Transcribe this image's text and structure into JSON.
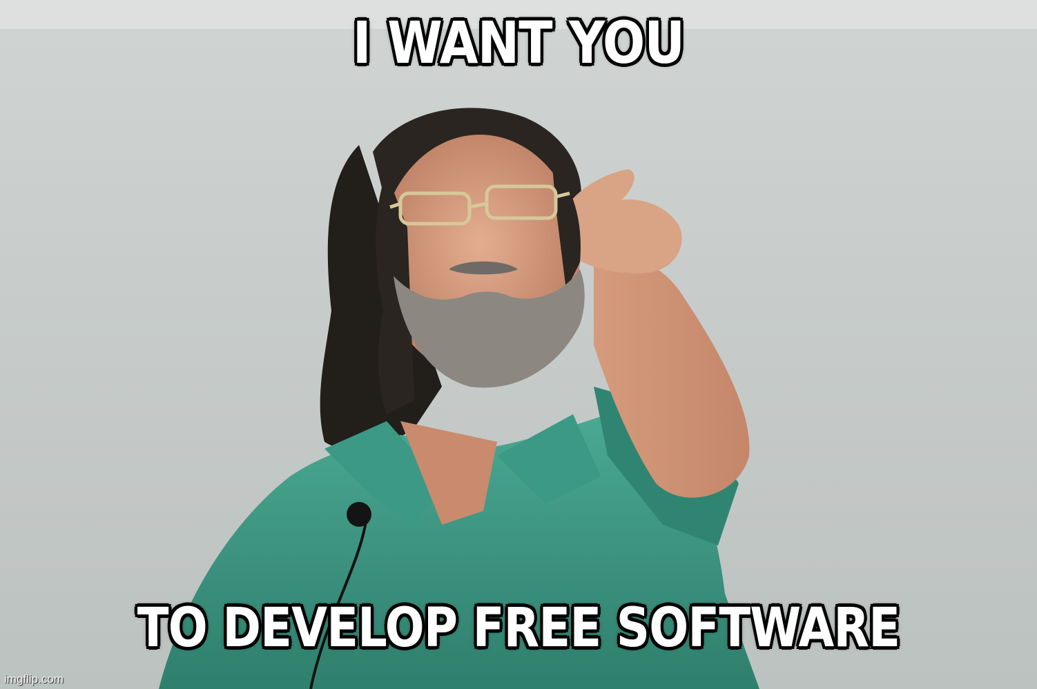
{
  "meme": {
    "top_text": "I WANT YOU",
    "bottom_text": "TO DEVELOP FREE SOFTWARE",
    "watermark": "imgflip.com"
  },
  "colors": {
    "background_wall": "#c9cdcb",
    "shirt": "#3f9a86",
    "skin": "#d9a083",
    "hair": "#24201c",
    "beard": "#8f8a84",
    "caption_fill": "#ffffff",
    "caption_outline": "#000000"
  }
}
